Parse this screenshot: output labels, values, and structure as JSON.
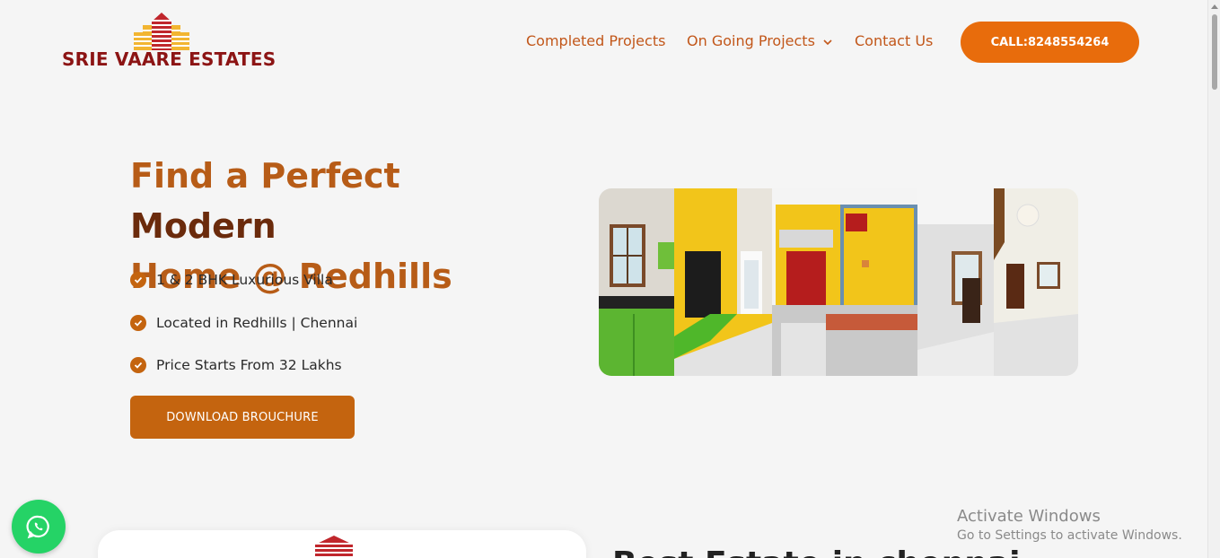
{
  "brand": {
    "name": "SRIE VAARE ESTATES"
  },
  "nav": {
    "items": [
      {
        "label": "Completed Projects"
      },
      {
        "label": "On Going Projects"
      },
      {
        "label": "Contact Us"
      }
    ],
    "call_label": "CALL:8248554264"
  },
  "hero": {
    "title_part1": "Find a Perfect ",
    "title_part2": "Modern",
    "title_part3": "Home @ Redhills",
    "features": [
      "1 & 2 BHK Luxurious Villa",
      "Located in Redhills | Chennai",
      "Price Starts From 32 Lakhs"
    ],
    "download_label": "DOWNLOAD BROUCHURE"
  },
  "section": {
    "heading": "Best Estate in chennai"
  },
  "os_notice": {
    "title": "Activate Windows",
    "subtitle": "Go to Settings to activate Windows."
  },
  "icons": {
    "check": "check-circle-icon",
    "whatsapp": "whatsapp-icon",
    "chevron": "chevron-down-icon"
  },
  "colors": {
    "accent": "#e86c0c",
    "brand_red": "#8c1414",
    "title_orange": "#b75c17",
    "title_dark": "#6b2b0c",
    "whatsapp": "#25d366"
  }
}
